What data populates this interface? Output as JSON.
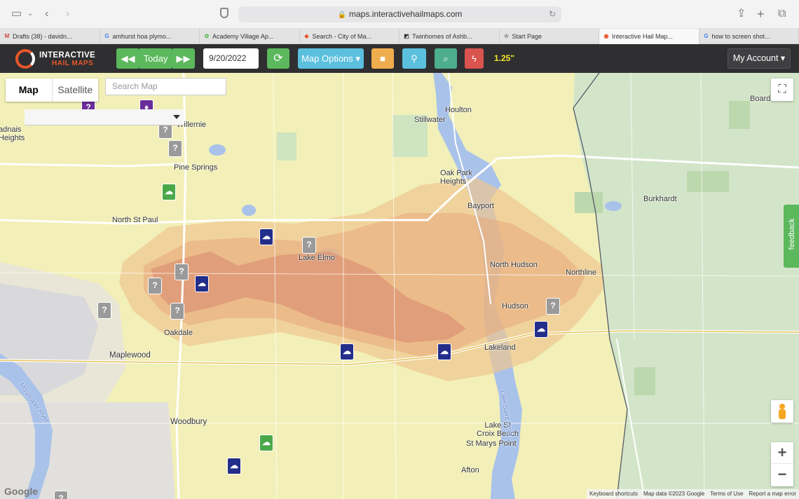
{
  "browser": {
    "url": "maps.interactivehailmaps.com",
    "tabs": [
      {
        "label": "Drafts (38) - davidn...",
        "favicon": "M",
        "favcolor": "#d44638"
      },
      {
        "label": "amhurst hoa plymo...",
        "favicon": "G",
        "favcolor": "#4285f4"
      },
      {
        "label": "Academy Village Ap...",
        "favicon": "✿",
        "favcolor": "#5cb85c"
      },
      {
        "label": "Search - City of Ma...",
        "favicon": "◆",
        "favcolor": "#e8572b"
      },
      {
        "label": "Twinhomes of Ashb...",
        "favicon": "◩",
        "favcolor": "#333"
      },
      {
        "label": "Start Page",
        "favicon": "☆",
        "favcolor": "#666"
      },
      {
        "label": "Interactive Hail Map...",
        "favicon": "◉",
        "favcolor": "#e8572b",
        "active": true
      },
      {
        "label": "how to screen shot...",
        "favicon": "G",
        "favcolor": "#4285f4"
      }
    ]
  },
  "toolbar": {
    "logo_line1": "INTERACTIVE",
    "logo_line2": "HAIL MAPS",
    "prev_icon": "double-left-icon",
    "today_label": "Today",
    "next_icon": "double-right-icon",
    "date_value": "9/20/2022",
    "refresh_icon": "refresh-icon",
    "map_options_label": "Map Options ▾",
    "video_icon": "video-icon",
    "pin_icon": "location-pin-icon",
    "search_icon": "search-icon",
    "lightning_icon": "lightning-icon",
    "hail_size": "1.25\"",
    "account_label": "My Account ▾"
  },
  "map": {
    "map_tab": "Map",
    "satellite_tab": "Satellite",
    "search_placeholder": "Search Map",
    "feedback_label": "feedback",
    "zoom_in": "+",
    "zoom_out": "−",
    "google_logo": "Google",
    "attribution": [
      "Keyboard shortcuts",
      "Map data ©2023 Google",
      "Terms of Use",
      "Report a map error"
    ],
    "places": {
      "houlton": "Houlton",
      "stillwater": "Stillwater",
      "willernie": "Willernie",
      "pine_springs": "Pine Springs",
      "oak_park_heights": "Oak Park Heights",
      "bayport": "Bayport",
      "north_st_paul": "North St Paul",
      "lake_elmo": "Lake Elmo",
      "north_hudson": "North Hudson",
      "northline": "Northline",
      "hudson": "Hudson",
      "oakdale": "Oakdale",
      "maplewood": "Maplewood",
      "lakeland": "Lakeland",
      "woodbury": "Woodbury",
      "lake_st_croix_beach": "Lake St Croix Beach",
      "st_marys_point": "St Marys Point",
      "afton": "Afton",
      "burkhardt": "Burkhardt",
      "boardman": "Boardman",
      "adnais_heights": "adnais Heights",
      "lake_saint_croix": "Lake Saint Croix",
      "mississippi_river": "Mississippi River"
    },
    "colors": {
      "base": "#f2f0b8",
      "green_region": "#cfe4c4",
      "water": "#a9c2ea",
      "swath_outer": "#f0c690",
      "swath_mid": "#e8a77a",
      "swath_core": "#d98a70",
      "marker_hail": "#232e8a",
      "marker_unknown": "#9a9a9a",
      "marker_green": "#4aa849",
      "state_border": "#555a66"
    }
  }
}
